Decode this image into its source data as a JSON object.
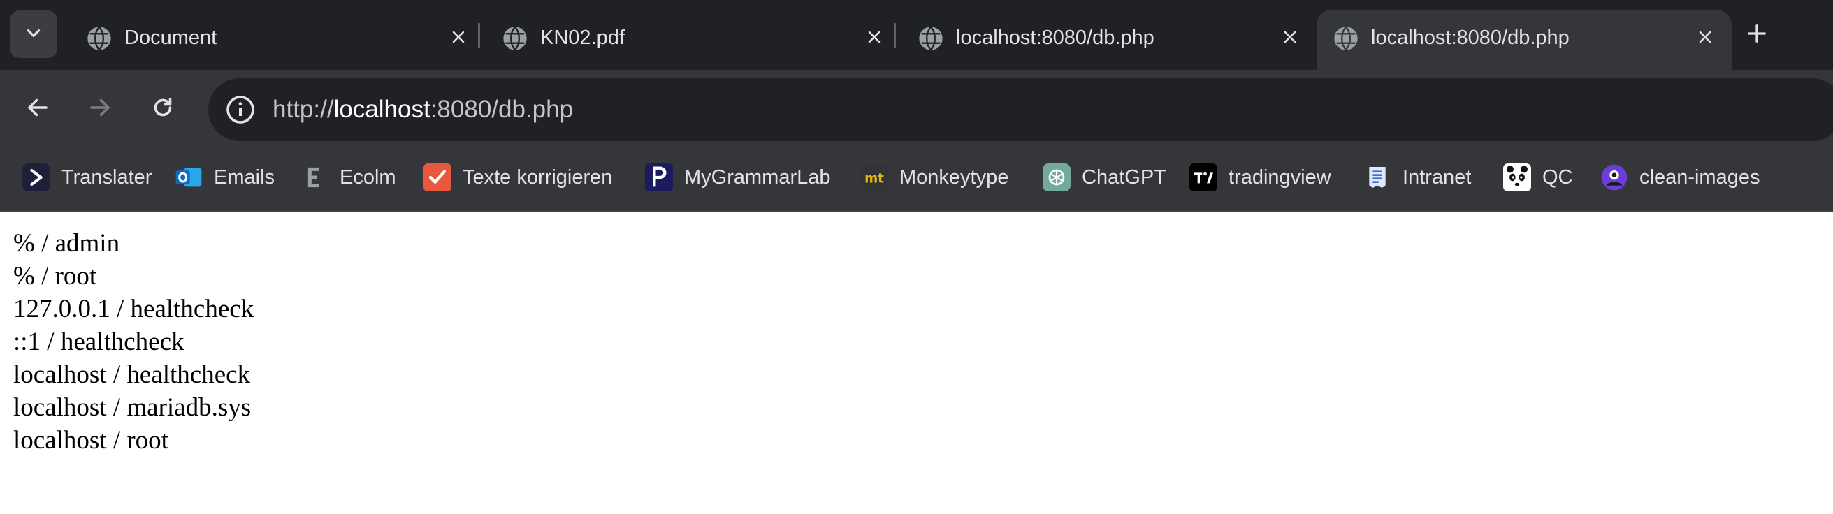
{
  "tabs": [
    {
      "title": "Document",
      "active": false
    },
    {
      "title": "KN02.pdf",
      "active": false
    },
    {
      "title": "localhost:8080/db.php",
      "active": false
    },
    {
      "title": "localhost:8080/db.php",
      "active": true
    }
  ],
  "address_bar": {
    "url_prefix": "http://",
    "url_host": "localhost",
    "url_rest": ":8080/db.php"
  },
  "bookmarks": [
    {
      "label": "Translater",
      "icon": "translater-icon",
      "color": "#1f1f3a"
    },
    {
      "label": "Emails",
      "icon": "outlook-icon",
      "color": "#1173c6"
    },
    {
      "label": "Ecolm",
      "icon": "ecolm-icon",
      "color": "#9aa0a6"
    },
    {
      "label": "Texte korrigieren",
      "icon": "texte-korrigieren-icon",
      "color": "#e8583f"
    },
    {
      "label": "MyGrammarLab",
      "icon": "mygrammarlab-icon",
      "color": "#1a1a5e"
    },
    {
      "label": "Monkeytype",
      "icon": "monkeytype-icon",
      "color": "#e2b714"
    },
    {
      "label": "ChatGPT",
      "icon": "chatgpt-icon",
      "color": "#74aa9c"
    },
    {
      "label": "tradingview",
      "icon": "tradingview-icon",
      "color": "#000000"
    },
    {
      "label": "Intranet",
      "icon": "intranet-icon",
      "color": "#3b6fd6"
    },
    {
      "label": "QC",
      "icon": "qc-icon",
      "color": "#ffffff"
    },
    {
      "label": "clean-images",
      "icon": "clean-images-icon",
      "color": "#6b3fd6"
    }
  ],
  "content": {
    "lines": [
      "% / admin",
      "% / root",
      "127.0.0.1 / healthcheck",
      "::1 / healthcheck",
      "localhost / healthcheck",
      "localhost / mariadb.sys",
      "localhost / root"
    ]
  }
}
